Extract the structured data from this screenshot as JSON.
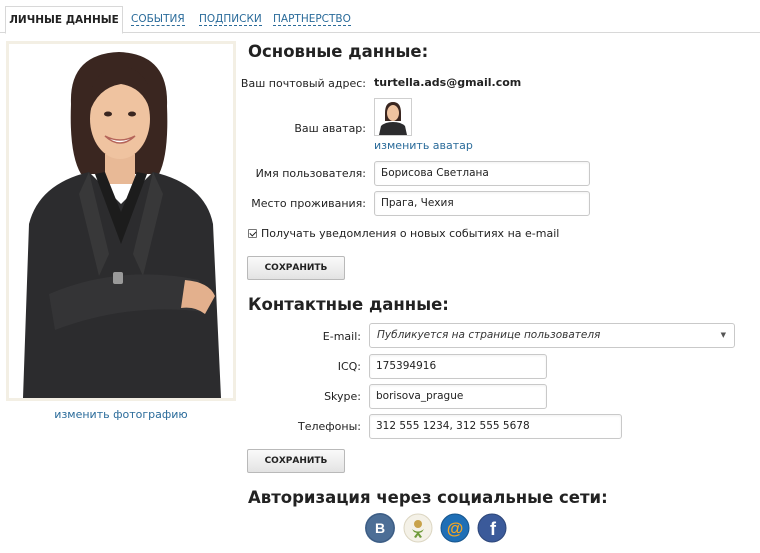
{
  "tabs": [
    {
      "label": "Личные данные"
    },
    {
      "label": "События"
    },
    {
      "label": "Подписки"
    },
    {
      "label": "Партнерство"
    }
  ],
  "photo": {
    "change_label": "изменить фотографию"
  },
  "basic": {
    "title": "Основные данные:",
    "email_label": "Ваш почтовый адрес:",
    "email_value": "turtella.ads@gmail.com",
    "avatar_label": "Ваш аватар:",
    "avatar_change": "изменить аватар",
    "username_label": "Имя пользователя:",
    "username_value": "Борисова Светлана",
    "location_label": "Место проживания:",
    "location_value": "Прага, Чехия",
    "notify_label": "Получать уведомления о новых событиях на e-mail",
    "notify_checked": true,
    "save_label": "СОХРАНИТЬ"
  },
  "contacts": {
    "title": "Контактные данные:",
    "email_label": "E-mail:",
    "email_select_value": "Публикуется на странице пользователя",
    "icq_label": "ICQ:",
    "icq_value": "175394916",
    "skype_label": "Skype:",
    "skype_value": "borisova_prague",
    "phones_label": "Телефоны:",
    "phones_value": "312 555 1234, 312 555 5678",
    "save_label": "СОХРАНИТЬ"
  },
  "social": {
    "title": "Авторизация через социальные сети:",
    "items": [
      {
        "icon": "vkontakte-icon",
        "glyph": "B",
        "color": "#4c6e96"
      },
      {
        "icon": "odnoklassniki-icon",
        "glyph": "",
        "color": "#f2f0e6"
      },
      {
        "icon": "mailru-icon",
        "glyph": "@",
        "color": "#1f6fb6"
      },
      {
        "icon": "facebook-icon",
        "glyph": "f",
        "color": "#3b5a9a"
      }
    ]
  }
}
